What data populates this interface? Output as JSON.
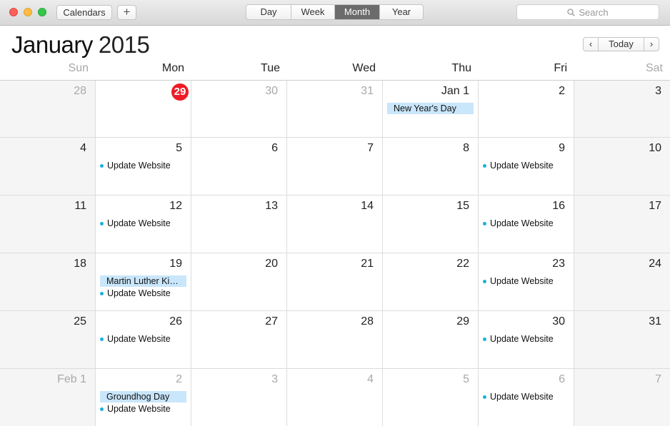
{
  "toolbar": {
    "calendars_label": "Calendars",
    "add_label": "+",
    "views": [
      "Day",
      "Week",
      "Month",
      "Year"
    ],
    "active_view": "Month",
    "search_placeholder": "Search"
  },
  "header": {
    "month": "January",
    "year": "2015",
    "today_label": "Today",
    "prev_symbol": "‹",
    "next_symbol": "›",
    "weekdays": [
      "Sun",
      "Mon",
      "Tue",
      "Wed",
      "Thu",
      "Fri",
      "Sat"
    ]
  },
  "colors": {
    "today_badge": "#ee1c25",
    "allday_event_bg": "#c9e6fa",
    "event_dot": "#1ab0dc",
    "active_segment": "#6b6b6b"
  },
  "weeks": [
    [
      {
        "label": "28",
        "dim": true,
        "events": []
      },
      {
        "label": "29",
        "today": true,
        "events": []
      },
      {
        "label": "30",
        "dim": true,
        "events": []
      },
      {
        "label": "31",
        "dim": true,
        "events": []
      },
      {
        "label": "Jan 1",
        "events": [
          {
            "kind": "allday",
            "title": "New Year's Day"
          }
        ]
      },
      {
        "label": "2",
        "events": []
      },
      {
        "label": "3",
        "events": []
      }
    ],
    [
      {
        "label": "4",
        "events": []
      },
      {
        "label": "5",
        "events": [
          {
            "kind": "timed",
            "title": "Update Website"
          }
        ]
      },
      {
        "label": "6",
        "events": []
      },
      {
        "label": "7",
        "events": []
      },
      {
        "label": "8",
        "events": []
      },
      {
        "label": "9",
        "events": [
          {
            "kind": "timed",
            "title": "Update Website"
          }
        ]
      },
      {
        "label": "10",
        "events": []
      }
    ],
    [
      {
        "label": "11",
        "events": []
      },
      {
        "label": "12",
        "events": [
          {
            "kind": "timed",
            "title": "Update Website"
          }
        ]
      },
      {
        "label": "13",
        "events": []
      },
      {
        "label": "14",
        "events": []
      },
      {
        "label": "15",
        "events": []
      },
      {
        "label": "16",
        "events": [
          {
            "kind": "timed",
            "title": "Update Website"
          }
        ]
      },
      {
        "label": "17",
        "events": []
      }
    ],
    [
      {
        "label": "18",
        "events": []
      },
      {
        "label": "19",
        "events": [
          {
            "kind": "allday",
            "title": "Martin Luther Ki…"
          },
          {
            "kind": "timed",
            "title": "Update Website"
          }
        ]
      },
      {
        "label": "20",
        "events": []
      },
      {
        "label": "21",
        "events": []
      },
      {
        "label": "22",
        "events": []
      },
      {
        "label": "23",
        "events": [
          {
            "kind": "timed",
            "title": "Update Website"
          }
        ]
      },
      {
        "label": "24",
        "events": []
      }
    ],
    [
      {
        "label": "25",
        "events": []
      },
      {
        "label": "26",
        "events": [
          {
            "kind": "timed",
            "title": "Update Website"
          }
        ]
      },
      {
        "label": "27",
        "events": []
      },
      {
        "label": "28",
        "events": []
      },
      {
        "label": "29",
        "events": []
      },
      {
        "label": "30",
        "events": [
          {
            "kind": "timed",
            "title": "Update Website"
          }
        ]
      },
      {
        "label": "31",
        "events": []
      }
    ],
    [
      {
        "label": "Feb 1",
        "dim": true,
        "events": []
      },
      {
        "label": "2",
        "dim": true,
        "events": [
          {
            "kind": "allday",
            "title": "Groundhog Day"
          },
          {
            "kind": "timed",
            "title": "Update Website"
          }
        ]
      },
      {
        "label": "3",
        "dim": true,
        "events": []
      },
      {
        "label": "4",
        "dim": true,
        "events": []
      },
      {
        "label": "5",
        "dim": true,
        "events": []
      },
      {
        "label": "6",
        "dim": true,
        "events": [
          {
            "kind": "timed",
            "title": "Update Website"
          }
        ]
      },
      {
        "label": "7",
        "dim": true,
        "events": []
      }
    ]
  ]
}
